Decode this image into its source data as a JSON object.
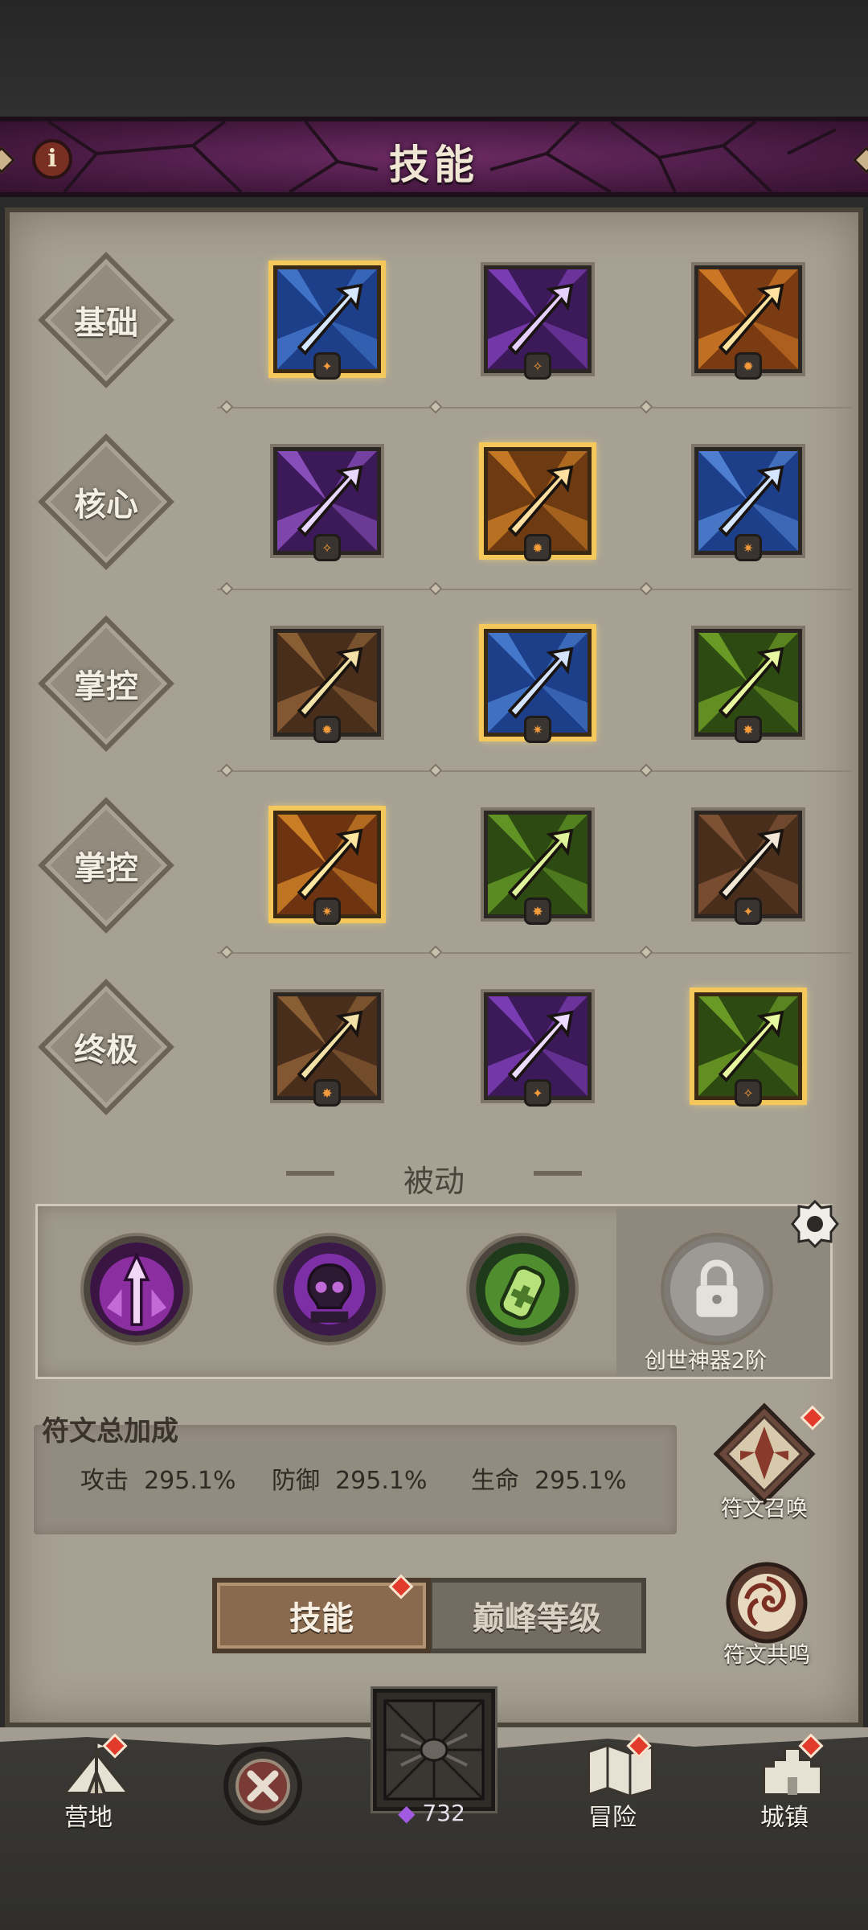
{
  "header": {
    "title": "技能",
    "info_icon": "i"
  },
  "skill_rows": [
    {
      "label": "基础",
      "skills": [
        {
          "name": "blue-arrow",
          "selected": true
        },
        {
          "name": "purple-arrows",
          "selected": false
        },
        {
          "name": "orange-fire-arrows",
          "selected": false
        }
      ]
    },
    {
      "label": "核心",
      "skills": [
        {
          "name": "purple-spirit",
          "selected": false
        },
        {
          "name": "orange-archer",
          "selected": true
        },
        {
          "name": "blue-spear",
          "selected": false
        }
      ]
    },
    {
      "label": "掌控",
      "skills": [
        {
          "name": "brown-tower",
          "selected": false
        },
        {
          "name": "blue-shade",
          "selected": true
        },
        {
          "name": "green-vines",
          "selected": false
        }
      ]
    },
    {
      "label": "掌控",
      "skills": [
        {
          "name": "orange-dash",
          "selected": true
        },
        {
          "name": "green-arrow-rain",
          "selected": false
        },
        {
          "name": "brown-hooded",
          "selected": false
        }
      ]
    },
    {
      "label": "终极",
      "skills": [
        {
          "name": "brown-crossbow",
          "selected": false
        },
        {
          "name": "purple-arrow-burst",
          "selected": false
        },
        {
          "name": "green-bone",
          "selected": true
        }
      ]
    }
  ],
  "passive": {
    "title": "被动",
    "slots": [
      "purple-arrow-orb",
      "skull-orb",
      "green-potion-orb"
    ],
    "locked_label": "创世神器2阶"
  },
  "rune_total": {
    "title": "符文总加成",
    "stats": [
      {
        "name": "攻击",
        "value": "295.1%"
      },
      {
        "name": "防御",
        "value": "295.1%"
      },
      {
        "name": "生命",
        "value": "295.1%"
      }
    ],
    "summon_label": "符文召唤",
    "resonance_label": "符文共鸣"
  },
  "tabs": {
    "active": "技能",
    "inactive": "巅峰等级"
  },
  "nav": {
    "camp": "营地",
    "adventure": "冒险",
    "town": "城镇",
    "gem_count": "732"
  },
  "colors": {
    "accent_purple": "#4a1b44",
    "panel": "#a7a194",
    "selected_gold": "#f4c85a",
    "notification_red": "#e23a2b"
  }
}
